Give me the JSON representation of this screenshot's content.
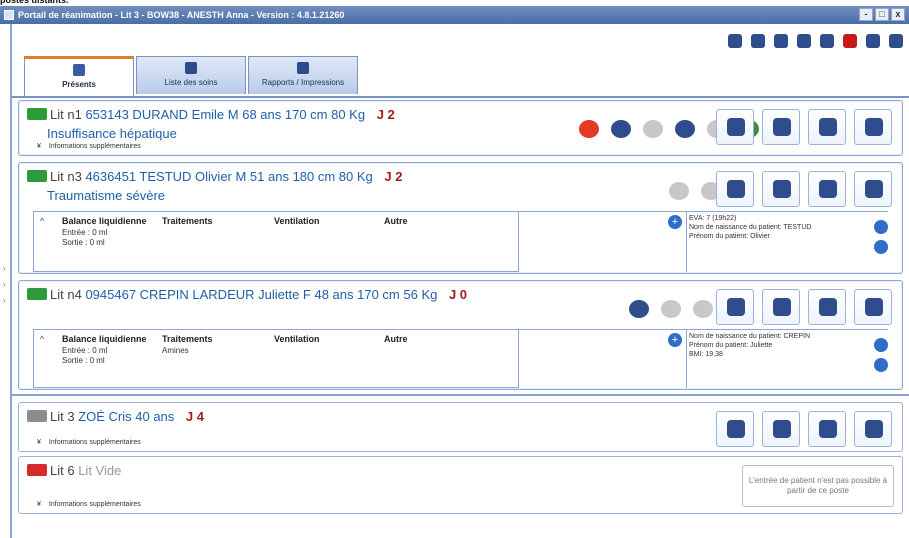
{
  "top_line": "postes distants.",
  "window": {
    "title": "Portail de réanimation - Lit 3 - BOW38 - ANESTH Anna - Version : 4.8.1.21260"
  },
  "window_buttons": [
    "-",
    "□",
    "x"
  ],
  "tabs": [
    {
      "label": "Présents",
      "icon": "house-icon"
    },
    {
      "label": "Liste des soins",
      "icon": "list-icon"
    },
    {
      "label": "Rapports / Impressions",
      "icon": "printer-icon"
    }
  ],
  "more_info_label": "Informations supplémentaires",
  "beds": [
    {
      "lit": "Lit n1",
      "patient": "653143 DURAND Emile M 68 ans 170 cm 80 Kg",
      "day": "J 2",
      "diagnosis": "Insuffisance hépatique"
    },
    {
      "lit": "Lit n3",
      "patient": "4636451 TESTUD Olivier M 51 ans 180 cm 80 Kg",
      "day": "J 2",
      "diagnosis": "Traumatisme sévère",
      "table": {
        "headers": [
          "Balance liquidienne",
          "Traitements",
          "Ventilation",
          "Autre"
        ],
        "lines": [
          "Entrée : 0 ml",
          "Sortie : 0 ml"
        ],
        "treatments": ""
      },
      "notes": [
        "EVA: 7  (19h22)",
        "Nom de naissance du patient: TESTUD",
        "Prénom du patient: Olivier"
      ]
    },
    {
      "lit": "Lit n4",
      "patient": "0945467 CREPIN LARDEUR Juliette F 48 ans 170 cm 56 Kg",
      "day": "J 0",
      "diagnosis": "",
      "table": {
        "headers": [
          "Balance liquidienne",
          "Traitements",
          "Ventilation",
          "Autre"
        ],
        "lines": [
          "Entrée : 0 ml",
          "Sortie : 0 ml"
        ],
        "treatments": "Amines"
      },
      "notes": [
        "Nom de naissance du patient: CREPIN",
        "Prénom du patient: Juliette",
        "BMI: 19,38"
      ]
    },
    {
      "lit": "Lit 3",
      "patient": "ZOÉ Cris 40 ans",
      "day": "J 4",
      "diagnosis": ""
    },
    {
      "lit": "Lit 6",
      "patient": "Lit Vide",
      "day": "",
      "diagnosis": "",
      "notice": "L'entrée de patient n'est pas possible à partir de ce poste"
    }
  ]
}
